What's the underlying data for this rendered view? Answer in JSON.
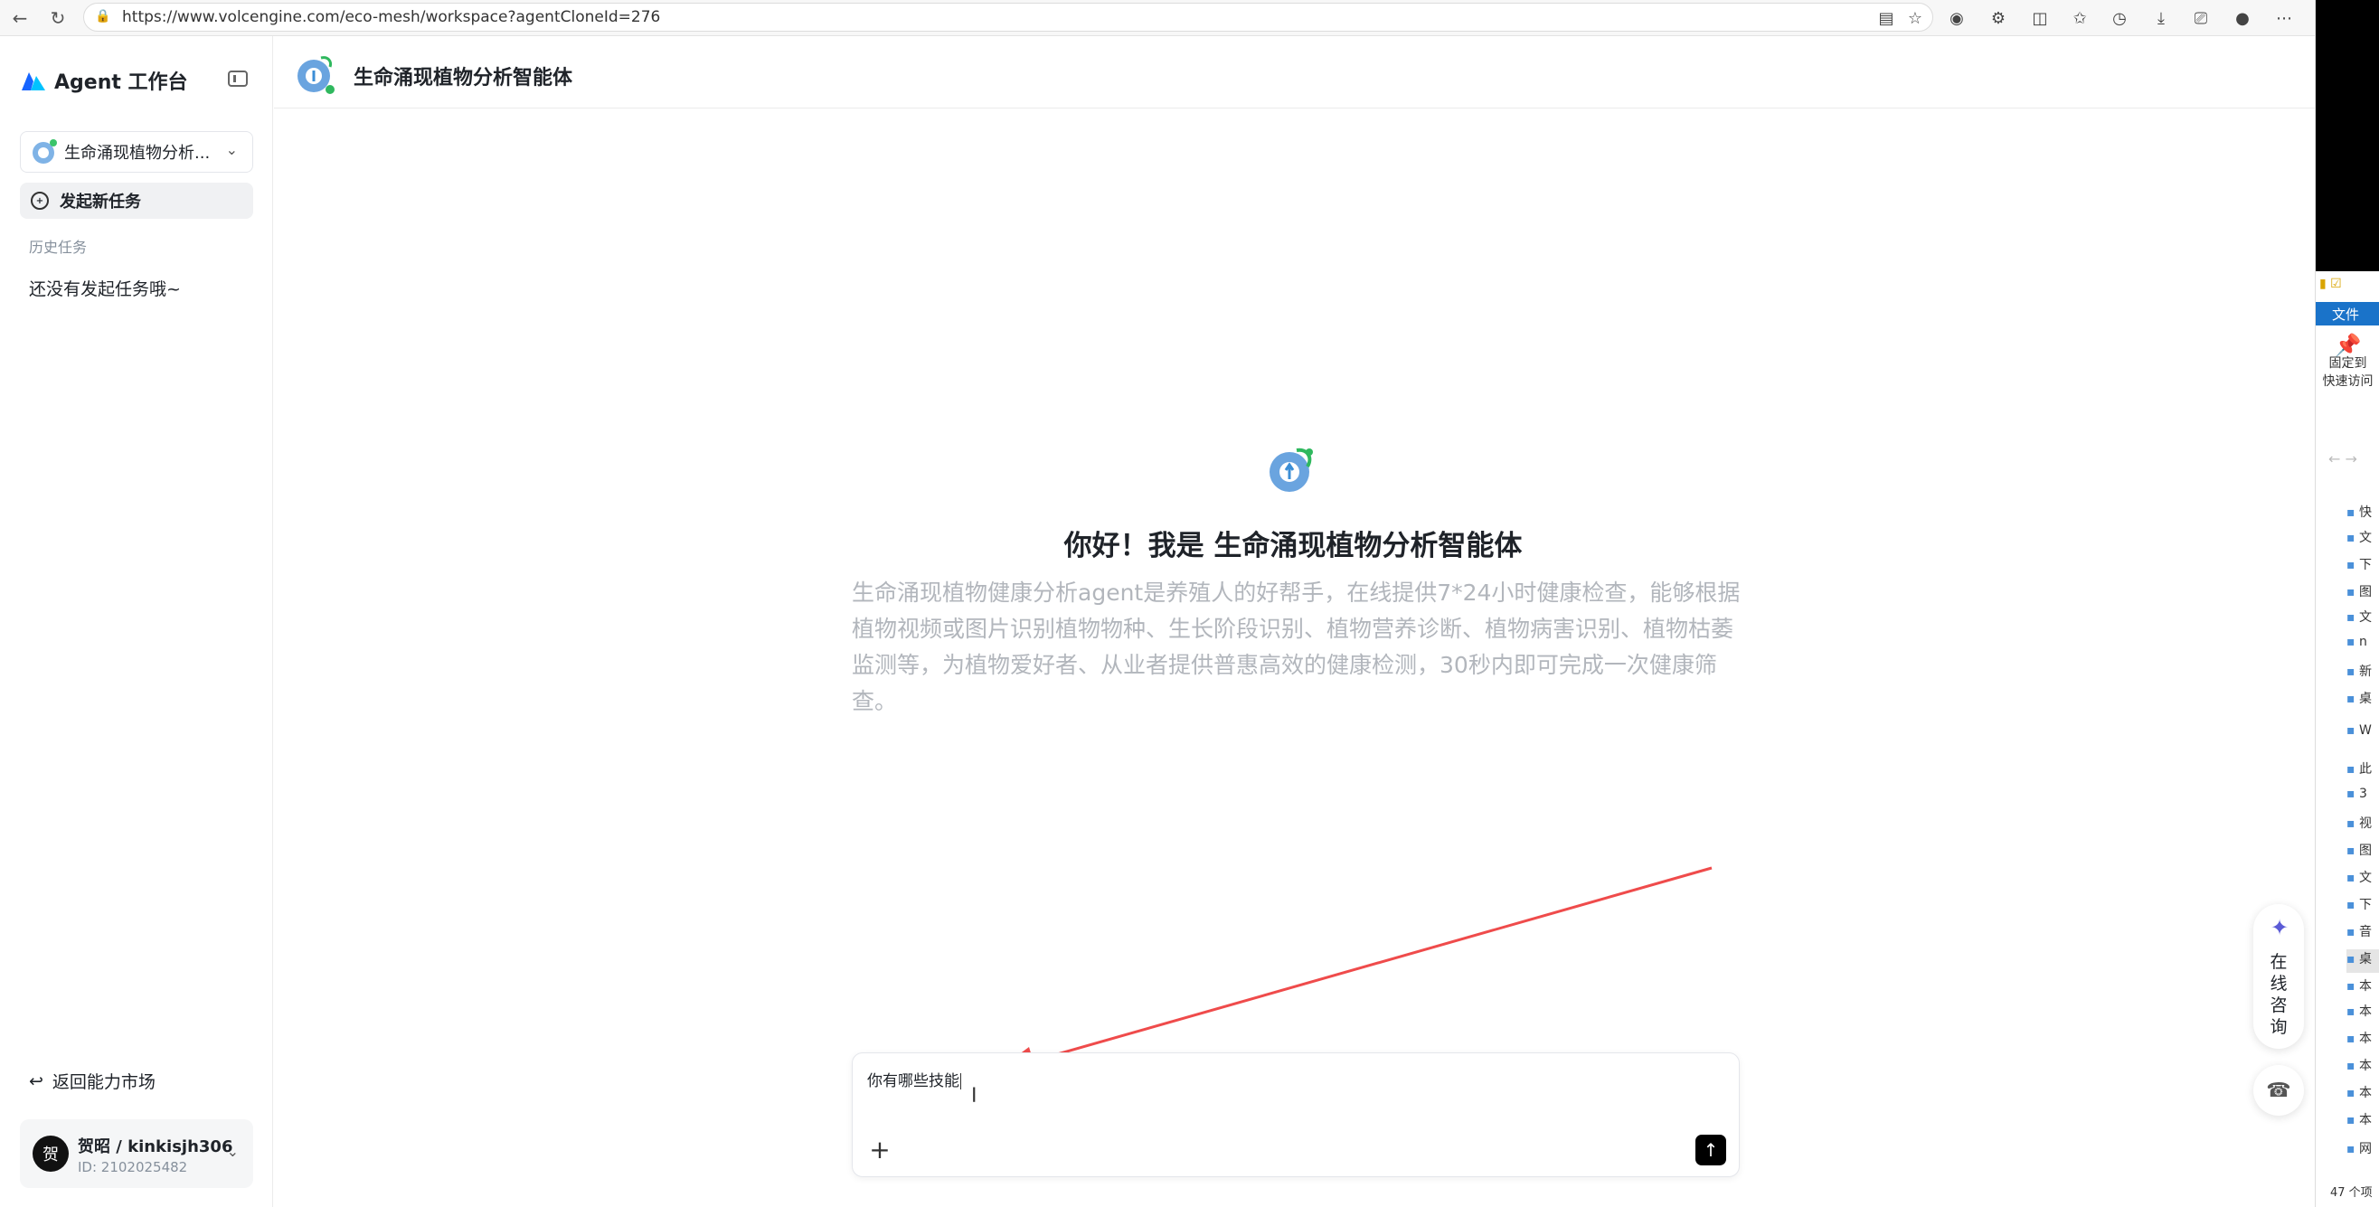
{
  "browser": {
    "url": "https://www.volcengine.com/eco-mesh/workspace?agentCloneId=276"
  },
  "sidebar": {
    "app_title": "Agent 工作台",
    "agent_select": "生命涌现植物分析...",
    "new_task": "发起新任务",
    "history_label": "历史任务",
    "history_empty": "还没有发起任务哦~",
    "back_market": "返回能力市场",
    "user": {
      "avatar": "贺",
      "name": "贺昭 / kinkisjh306",
      "id": "ID: 2102025482"
    }
  },
  "header": {
    "title": "生命涌现植物分析智能体"
  },
  "welcome": {
    "title": "你好！我是 生命涌现植物分析智能体",
    "description": "生命涌现植物健康分析agent是养殖人的好帮手，在线提供7*24小时健康检查，能够根据植物视频或图片识别植物物种、生长阶段识别、植物营养诊断、植物病害识别、植物枯萎监测等，为植物爱好者、从业者提供普惠高效的健康检测，30秒内即可完成一次健康筛查。"
  },
  "input": {
    "value": "你有哪些技能"
  },
  "consult": {
    "label": "在线咨询"
  },
  "explorer": {
    "tab": "文件",
    "pin_line1": "固定到",
    "pin_line2": "快速访问",
    "rows": [
      "快",
      "文",
      "下",
      "图",
      "文",
      "n",
      "新",
      "桌",
      "W",
      "此",
      "3",
      "视",
      "图",
      "文",
      "下",
      "音",
      "桌",
      "本",
      "本",
      "本",
      "本",
      "本",
      "本",
      "网"
    ],
    "count": "47 个项"
  },
  "colors": {
    "arrow": "#ef4b4b",
    "accent": "#1a73c9"
  }
}
